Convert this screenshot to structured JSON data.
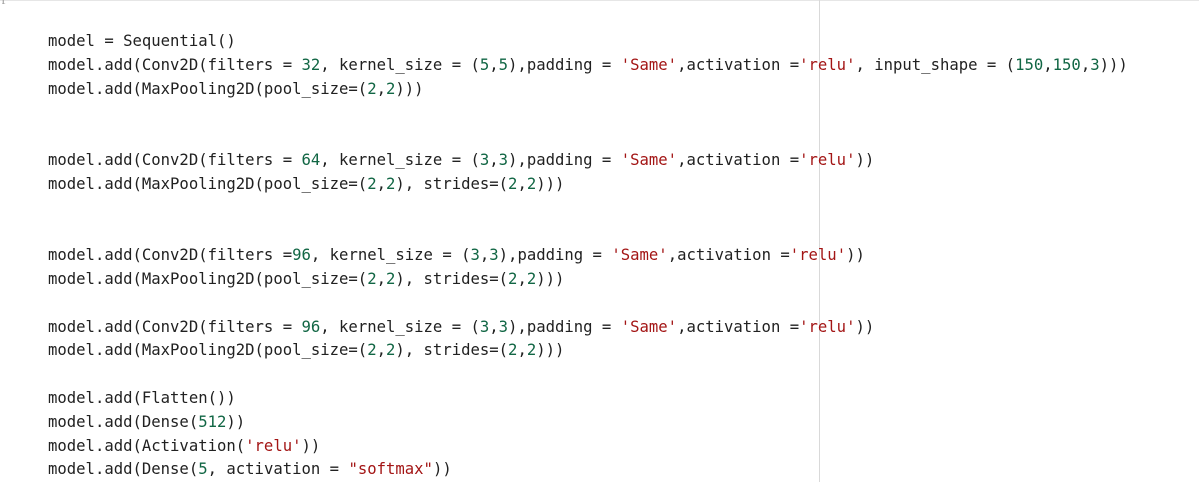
{
  "cell": {
    "prompt": "[ ]"
  },
  "code_lines": [
    "model = Sequential()",
    "model.add(Conv2D(filters = 32, kernel_size = (5,5),padding = 'Same',activation ='relu', input_shape = (150,150,3)))",
    "model.add(MaxPooling2D(pool_size=(2,2)))",
    "",
    "",
    "model.add(Conv2D(filters = 64, kernel_size = (3,3),padding = 'Same',activation ='relu'))",
    "model.add(MaxPooling2D(pool_size=(2,2), strides=(2,2)))",
    "",
    "",
    "model.add(Conv2D(filters =96, kernel_size = (3,3),padding = 'Same',activation ='relu'))",
    "model.add(MaxPooling2D(pool_size=(2,2), strides=(2,2)))",
    "",
    "model.add(Conv2D(filters = 96, kernel_size = (3,3),padding = 'Same',activation ='relu'))",
    "model.add(MaxPooling2D(pool_size=(2,2), strides=(2,2)))",
    "",
    "model.add(Flatten())",
    "model.add(Dense(512))",
    "model.add(Activation('relu'))",
    "model.add(Dense(5, activation = \"softmax\"))"
  ],
  "colors": {
    "text": "#212121",
    "number": "#116644",
    "string": "#a31515",
    "ruler": "#d9d9d9",
    "background": "#ffffff"
  }
}
